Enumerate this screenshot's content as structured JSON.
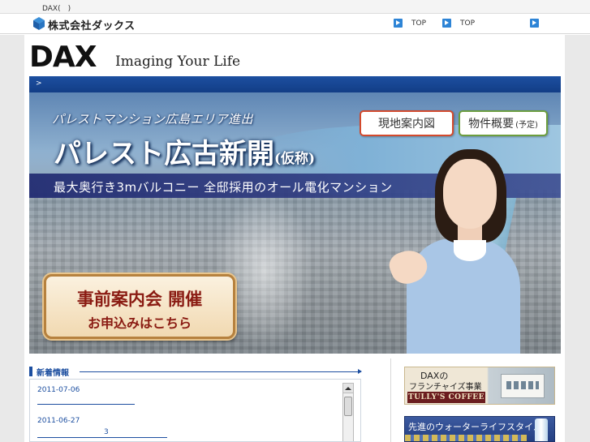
{
  "topbar": {
    "text": "DAX(　)"
  },
  "header": {
    "company_name": "株式会社ダックス",
    "nav": [
      {
        "label": "TOP"
      },
      {
        "label": "TOP"
      }
    ]
  },
  "brand": {
    "logo_text": "DAX",
    "tagline": "Imaging Your Life"
  },
  "hero": {
    "subtitle": "パレストマンション広島エリア進出",
    "title": "パレスト広古新開",
    "title_suffix": "(仮称)",
    "band_text": "最大奥行き3mバルコニー 全邸採用のオール電化マンション",
    "map_button": "現地案内図",
    "overview_button": "物件概要",
    "overview_note": "(予定)",
    "event_line1": "事前案内会 開催",
    "event_line2": "お申込みはこちら"
  },
  "news": {
    "heading": "新着情報",
    "items": [
      {
        "date": "2011-07-06"
      },
      {
        "date": "2011-06-27",
        "num": "3"
      }
    ]
  },
  "side": {
    "tullys_line1": "DAXの",
    "tullys_line2": "フランチャイズ事業",
    "tullys_logo": "TULLY'S COFFEE",
    "water_text": "先進のウォーターライフスタイル"
  },
  "colors": {
    "accent": "#1d4fa0",
    "nav_arrow": "#2d84d6"
  }
}
